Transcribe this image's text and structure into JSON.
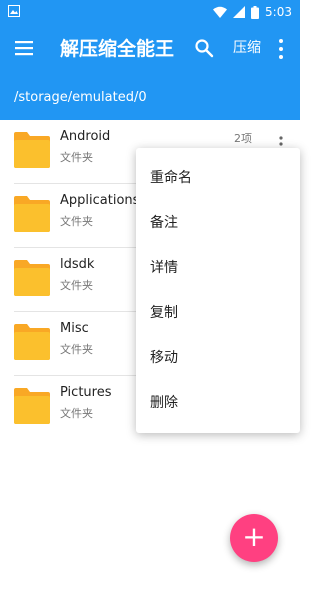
{
  "app": {
    "title": "解压缩全能王",
    "compress_label": "压缩",
    "path": "/storage/emulated/0"
  },
  "status_bar": {
    "time": "5:03"
  },
  "files": [
    {
      "name": "Android",
      "type": "文件夹",
      "count": "2项"
    },
    {
      "name": "Applications",
      "type": "文件夹",
      "count": ""
    },
    {
      "name": "ldsdk",
      "type": "文件夹",
      "count": ""
    },
    {
      "name": "Misc",
      "type": "文件夹",
      "count": ""
    },
    {
      "name": "Pictures",
      "type": "文件夹",
      "count": ""
    }
  ],
  "context_menu": {
    "items": [
      {
        "label": "重命名"
      },
      {
        "label": "备注"
      },
      {
        "label": "详情"
      },
      {
        "label": "复制"
      },
      {
        "label": "移动"
      },
      {
        "label": "删除"
      }
    ]
  },
  "fab": {
    "label": "+"
  },
  "colors": {
    "primary": "#2196F3",
    "accent": "#FF4081",
    "folder": "#FBC02D"
  }
}
